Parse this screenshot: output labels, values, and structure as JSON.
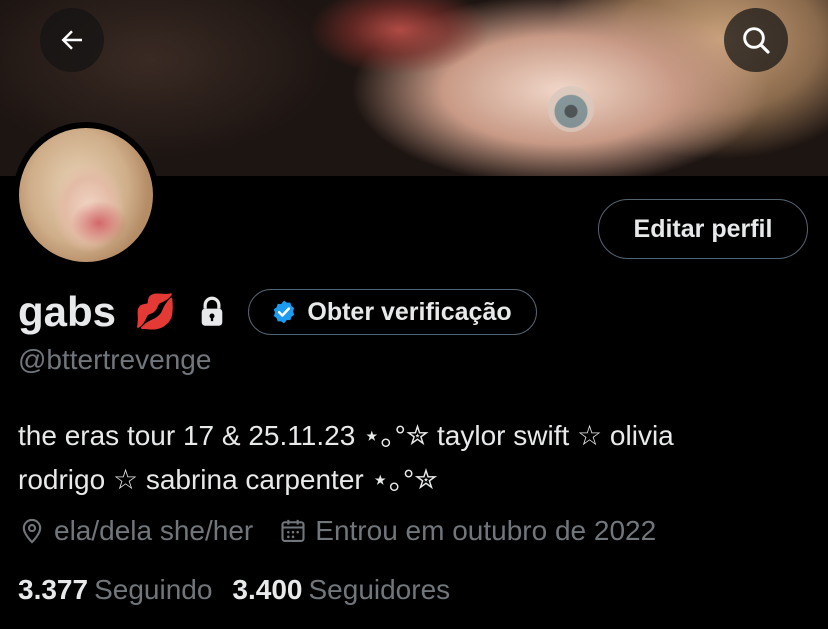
{
  "header": {
    "back_icon": "arrow-left-icon",
    "search_icon": "search-icon"
  },
  "profile": {
    "name": "gabs",
    "name_emoji": "💋",
    "lock_icon": "lock-icon",
    "verify_button": "Obter verificação",
    "verify_icon": "verified-badge-icon",
    "handle": "@bttertrevenge",
    "edit_button": "Editar perfil",
    "bio_line1": "the eras tour 17 & 25.11.23 ⋆｡°✮ taylor swift ☆ olivia",
    "bio_line2": "rodrigo ☆ sabrina carpenter ⋆｡°✮",
    "pronouns": "ela/dela she/her",
    "joined": "Entrou em outubro de 2022",
    "following_count": "3.377",
    "following_label": "Seguindo",
    "followers_count": "3.400",
    "followers_label": "Seguidores"
  },
  "colors": {
    "background": "#000000",
    "text": "#e7e9ea",
    "muted": "#71767b",
    "border": "#536471",
    "verified_blue": "#1d9bf0"
  }
}
